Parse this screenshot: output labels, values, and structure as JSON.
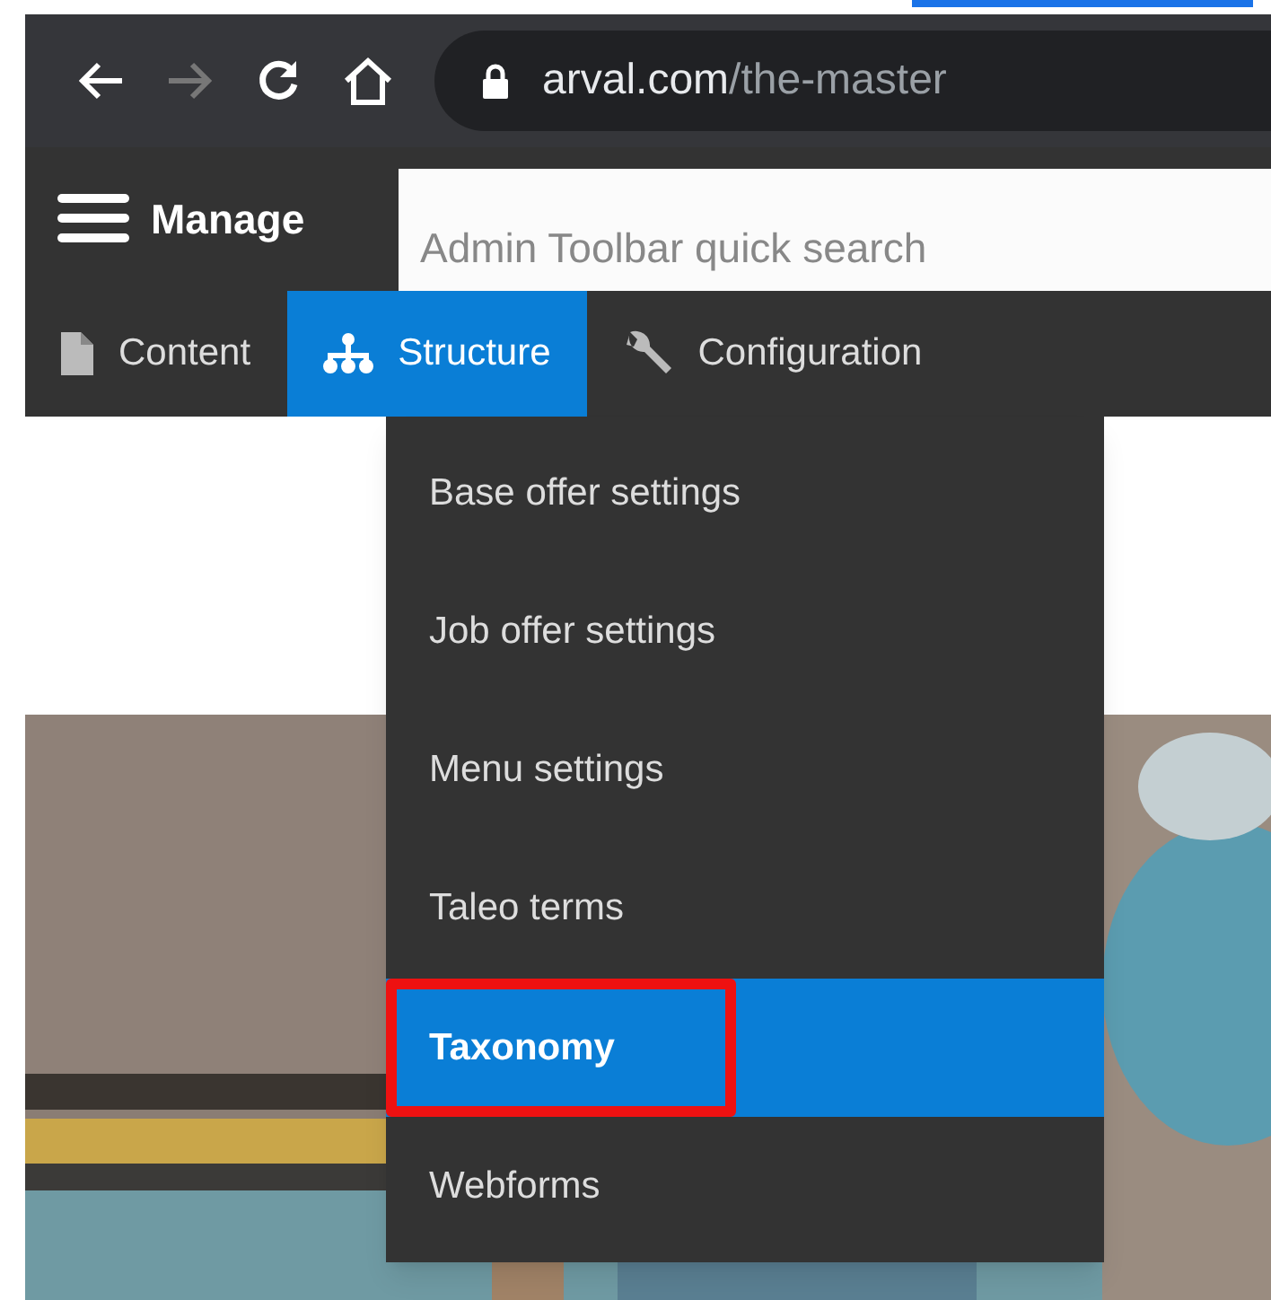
{
  "browser": {
    "url_host": "arval.com",
    "url_path": "/the-master",
    "forward_disabled": true
  },
  "toolbar": {
    "manage_label": "Manage",
    "search": {
      "placeholder": "Admin Toolbar quick search"
    },
    "tabs": [
      {
        "label": "Content",
        "kind": "file",
        "selected": false
      },
      {
        "label": "Structure",
        "kind": "sitemap",
        "selected": true
      },
      {
        "label": "Configuration",
        "kind": "wrench",
        "selected": false
      }
    ]
  },
  "menu": {
    "items": [
      {
        "label": "Base offer settings",
        "selected": false,
        "outlined": false
      },
      {
        "label": "Job offer settings",
        "selected": false,
        "outlined": false
      },
      {
        "label": "Menu settings",
        "selected": false,
        "outlined": false
      },
      {
        "label": "Taleo terms",
        "selected": false,
        "outlined": false
      },
      {
        "label": "Taxonomy",
        "selected": true,
        "outlined": true
      },
      {
        "label": "Webforms",
        "selected": false,
        "outlined": false
      }
    ]
  }
}
